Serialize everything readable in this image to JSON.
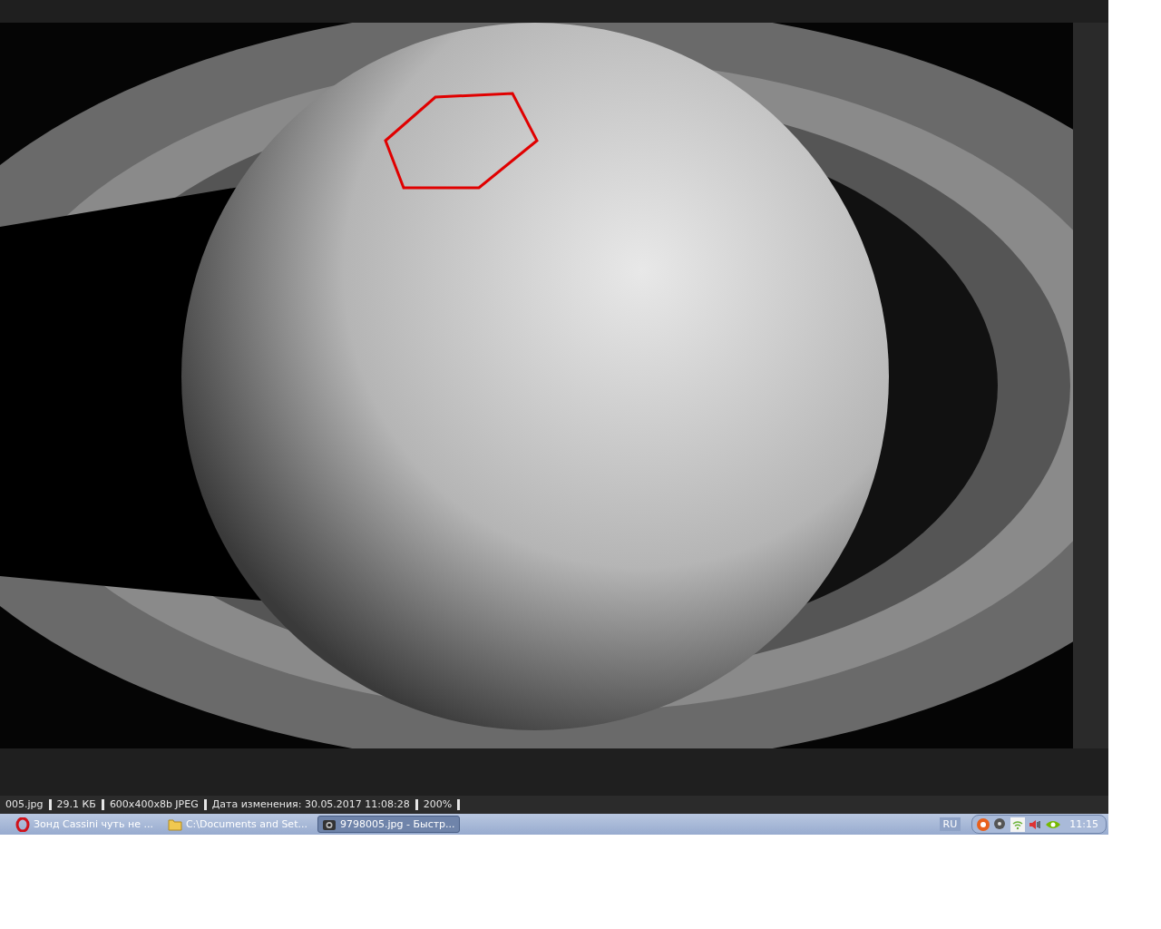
{
  "status_bar": {
    "fields": [
      "005.jpg",
      "29.1 КБ",
      "600x400x8b JPEG",
      "Дата изменения: 30.05.2017 11:08:28",
      "200%"
    ]
  },
  "taskbar": {
    "buttons": [
      {
        "label": "Зонд Cassini чуть не ...",
        "kind": "browser",
        "selected": false
      },
      {
        "label": "C:\\Documents and Set...",
        "kind": "folder",
        "selected": false
      },
      {
        "label": "9798005.jpg - Быстр...",
        "kind": "viewer",
        "selected": true
      }
    ],
    "language": "RU",
    "clock": "11:15"
  }
}
